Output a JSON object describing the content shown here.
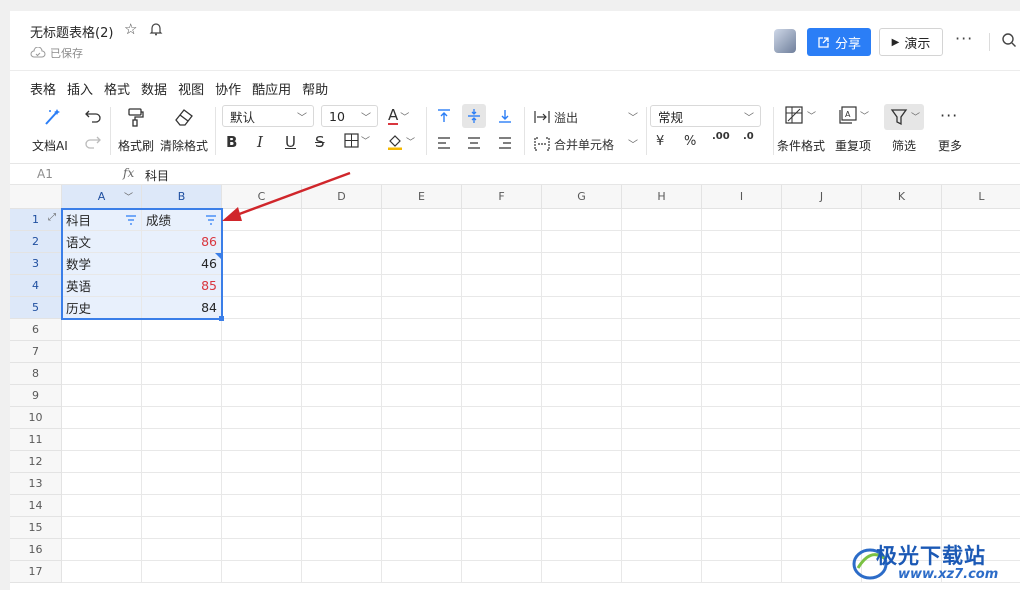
{
  "header": {
    "doc_title": "无标题表格(2)",
    "saved_status": "已保存",
    "share_label": "分享",
    "present_label": "演示"
  },
  "menu": [
    "表格",
    "插入",
    "格式",
    "数据",
    "视图",
    "协作",
    "酷应用",
    "帮助"
  ],
  "toolbar": {
    "doc_ai_label": "文档AI",
    "format_painter_label": "格式刷",
    "clear_format_label": "清除格式",
    "font_name": "默认",
    "font_size": "10",
    "overflow_label": "溢出",
    "merge_label": "合并单元格",
    "number_format": "常规",
    "currency_symbol": "¥",
    "percent_symbol": "%",
    "dec_increase": ".00",
    "dec_decrease": ".0",
    "conditional_format_label": "条件格式",
    "duplicate_label": "重复项",
    "filter_label": "筛选",
    "more_label": "更多"
  },
  "formula_bar": {
    "cell_ref": "A1",
    "fx": "fx",
    "value": "科目"
  },
  "grid": {
    "columns": [
      "A",
      "B",
      "C",
      "D",
      "E",
      "F",
      "G",
      "H",
      "I",
      "J",
      "K",
      "L"
    ],
    "rows": [
      "1",
      "2",
      "3",
      "4",
      "5",
      "6",
      "7",
      "8",
      "9",
      "10",
      "11",
      "12",
      "13",
      "14",
      "15",
      "16",
      "17"
    ],
    "headers": [
      "科目",
      "成绩"
    ],
    "data": [
      {
        "subject": "语文",
        "score": "86"
      },
      {
        "subject": "数学",
        "score": "46"
      },
      {
        "subject": "英语",
        "score": "85"
      },
      {
        "subject": "历史",
        "score": "84"
      }
    ]
  },
  "watermark": {
    "brand": "极光下载站",
    "url": "www.xz7.com"
  },
  "colors": {
    "accent": "#2b7ef6",
    "selection": "#3a7ee8",
    "highlight_red": "#d9363e",
    "arrow": "#d0262b"
  }
}
